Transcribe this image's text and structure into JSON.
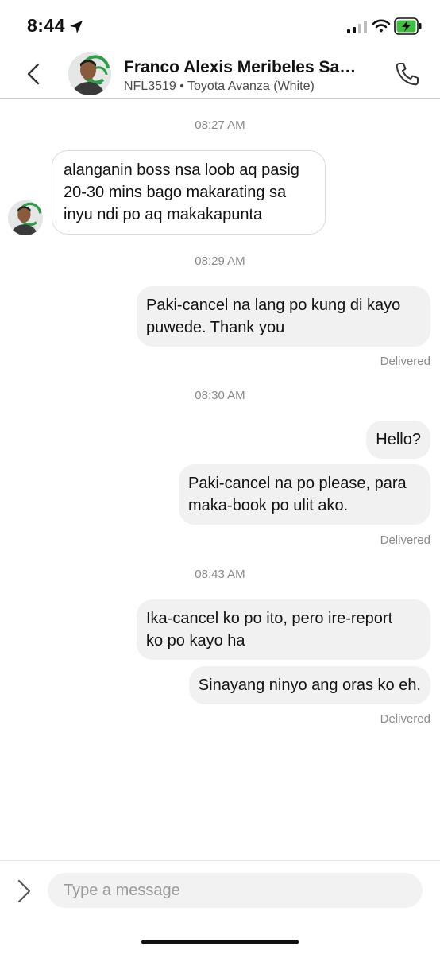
{
  "status_bar": {
    "time": "8:44",
    "icons": [
      "location-arrow-icon",
      "cellular-signal-icon",
      "wifi-icon",
      "battery-charging-icon"
    ]
  },
  "header": {
    "back_icon": "chevron-left-icon",
    "contact_name": "Franco Alexis Meribeles Sant…",
    "vehicle_info": "NFL3519 • Toyota Avanza (White)",
    "call_icon": "phone-icon"
  },
  "messages": {
    "ts1": "08:27 AM",
    "m1_lines": [
      "alanganin boss nsa loob aq pasig",
      "20-30 mins bago makarating sa",
      "inyu  ndi po aq makakapunta"
    ],
    "ts2": "08:29 AM",
    "m2_lines": [
      "Paki-cancel na lang po kung di kayo",
      "puwede. Thank you"
    ],
    "m2_status": "Delivered",
    "ts3": "08:30 AM",
    "m3": "Hello?",
    "m4_lines": [
      "Paki-cancel na po please, para",
      "maka-book po ulit ako."
    ],
    "m4_status": "Delivered",
    "ts4": "08:43 AM",
    "m5_lines": [
      "Ika-cancel ko po ito, pero ire-report",
      "ko po kayo ha"
    ],
    "m6": "Sinayang ninyo ang oras ko eh.",
    "m6_status": "Delivered"
  },
  "composer": {
    "expand_icon": "chevron-right-icon",
    "placeholder": "Type a message"
  },
  "colors": {
    "outgoing_bubble": "#f1f1f1",
    "incoming_border": "#dcdcdc",
    "meta_text": "#8a8a8a",
    "battery_green": "#3fbf3f"
  }
}
